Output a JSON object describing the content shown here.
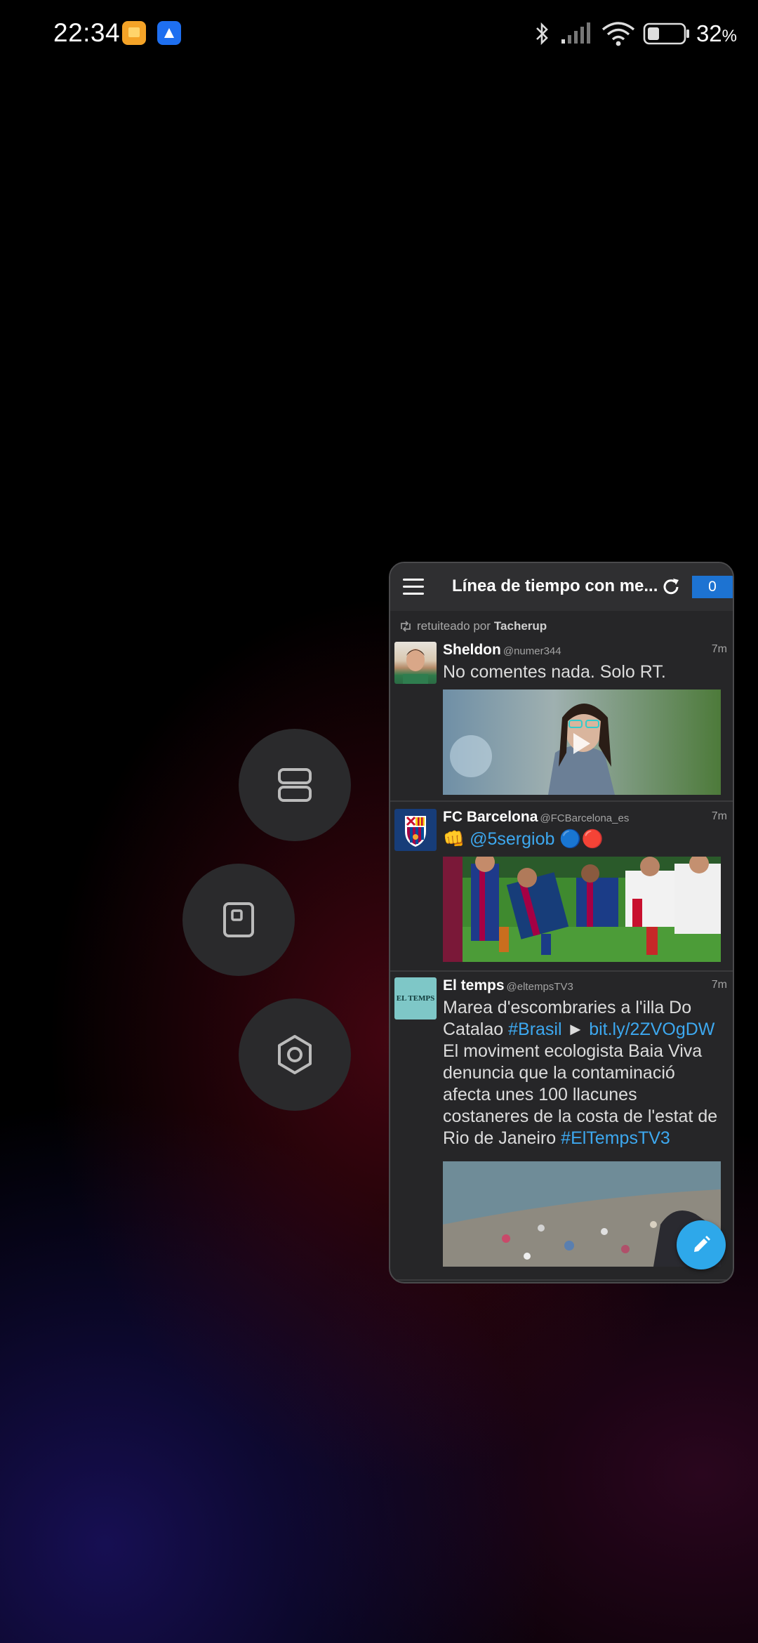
{
  "status_bar": {
    "time": "22:34",
    "battery_percent": "32",
    "battery_unit": "%",
    "notification_icons": [
      "gallery-app-icon",
      "navigation-app-icon"
    ],
    "system_icons": [
      "bluetooth-icon",
      "signal-icon",
      "wifi-icon",
      "battery-icon"
    ]
  },
  "floating_controls": [
    "split-screen-icon",
    "small-window-icon",
    "settings-icon"
  ],
  "window": {
    "title": "Línea de tiempo con me...",
    "unread_count": "0",
    "icons": [
      "menu-icon",
      "refresh-icon"
    ],
    "retweet_notice": {
      "prefix": "retuiteado por",
      "user": "Tacherup"
    },
    "tweets": [
      {
        "name": "Sheldon",
        "handle": "@numer344",
        "time": "7m",
        "text": "No comentes nada. Solo RT.",
        "media": "video-thumbnail"
      },
      {
        "name": "FC Barcelona",
        "handle": "@FCBarcelona_es",
        "time": "7m",
        "text_prefix": "👊",
        "mention": "@5sergiob",
        "text_suffix": "🔵🔴",
        "media": "football-photo"
      },
      {
        "name": "El temps",
        "handle": "@eltempsTV3",
        "time": "7m",
        "avatar_text": "EL TEMPS",
        "text_part1": "Marea d'escombraries a l'illa Do Catalao",
        "hashtag1": "#Brasil",
        "arrow": "►",
        "link": "bit.ly/2ZVOgDW",
        "text_part2": "El moviment ecologista Baia Viva denuncia que la contaminació afecta unes 100 llacunes costaneres de la costa de l'estat de Rio de Janeiro",
        "hashtag2": "#ElTempsTV3",
        "media": "beach-pollution-photo"
      }
    ],
    "compose_icon": "pencil-icon"
  }
}
